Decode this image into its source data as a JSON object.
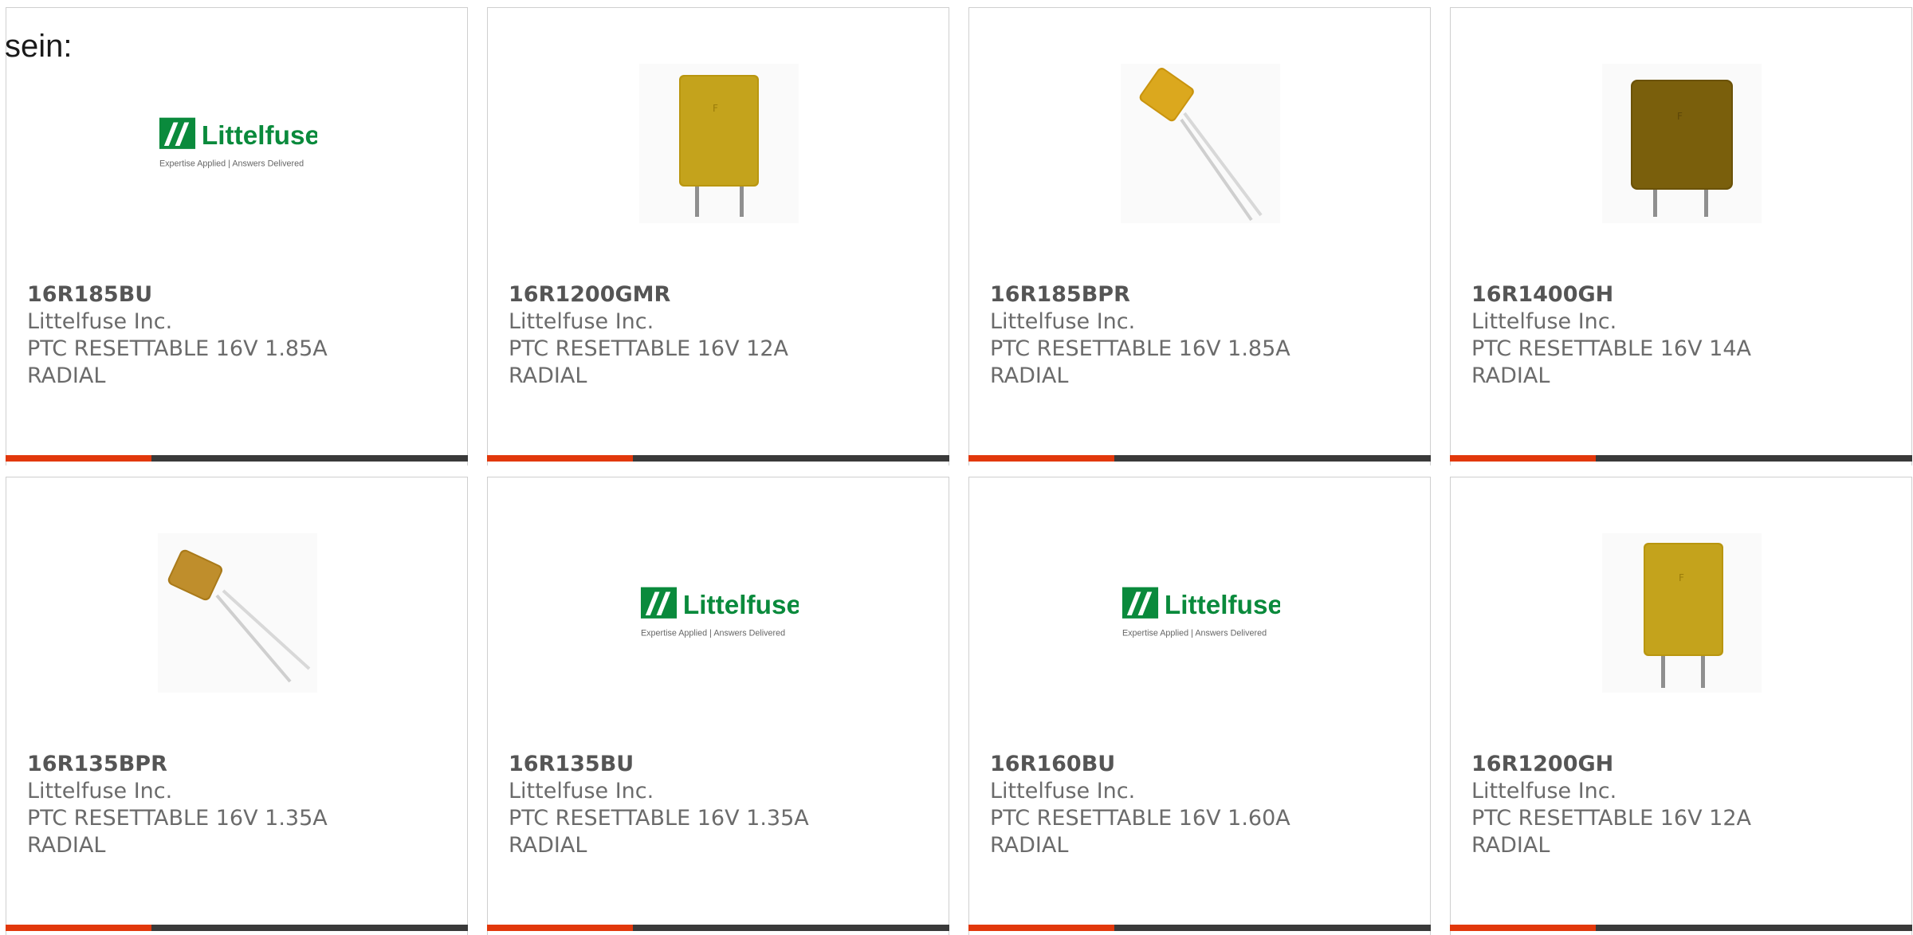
{
  "intro_text": "sein:",
  "colors": {
    "accent": "#e2380b",
    "bar": "#3a3a3a",
    "logo_green": "#0a8a3c"
  },
  "logo": {
    "name": "Littelfuse",
    "tagline": "Expertise Applied | Answers Delivered"
  },
  "cards": [
    {
      "part_number": "16R185BU",
      "manufacturer": "Littelfuse Inc.",
      "description": "PTC RESETTABLE 16V 1.85A\nRADIAL",
      "image": "littelfuse-logo"
    },
    {
      "part_number": "16R1200GMR",
      "manufacturer": "Littelfuse Inc.",
      "description": "PTC RESETTABLE 16V 12A\nRADIAL",
      "image": "ptc-rectangular-fuse"
    },
    {
      "part_number": "16R185BPR",
      "manufacturer": "Littelfuse Inc.",
      "description": "PTC RESETTABLE 16V 1.85A\nRADIAL",
      "image": "ptc-small-angled-fuse"
    },
    {
      "part_number": "16R1400GH",
      "manufacturer": "Littelfuse Inc.",
      "description": "PTC RESETTABLE 16V 14A\nRADIAL",
      "image": "ptc-dark-rectangular-fuse"
    },
    {
      "part_number": "16R135BPR",
      "manufacturer": "Littelfuse Inc.",
      "description": "PTC RESETTABLE 16V 1.35A\nRADIAL",
      "image": "ptc-small-angled-fuse"
    },
    {
      "part_number": "16R135BU",
      "manufacturer": "Littelfuse Inc.",
      "description": "PTC RESETTABLE 16V 1.35A\nRADIAL",
      "image": "littelfuse-logo"
    },
    {
      "part_number": "16R160BU",
      "manufacturer": "Littelfuse Inc.",
      "description": "PTC RESETTABLE 16V 1.60A\nRADIAL",
      "image": "littelfuse-logo"
    },
    {
      "part_number": "16R1200GH",
      "manufacturer": "Littelfuse Inc.",
      "description": "PTC RESETTABLE 16V 12A\nRADIAL",
      "image": "ptc-rectangular-fuse"
    }
  ]
}
